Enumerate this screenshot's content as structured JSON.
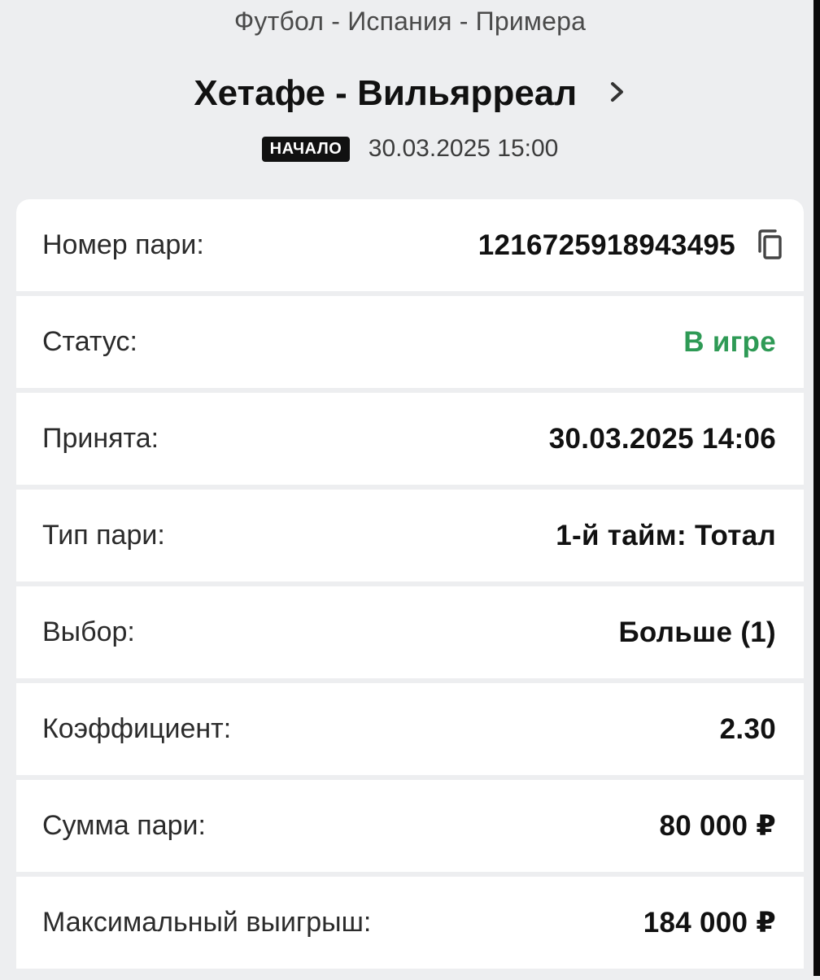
{
  "header": {
    "breadcrumb": "Футбол - Испания - Примера",
    "match_title": "Хетафе - Вильярреал",
    "start_badge": "НАЧАЛО",
    "start_datetime": "30.03.2025 15:00"
  },
  "bet_details": {
    "rows": [
      {
        "label": "Номер пари:",
        "value": "1216725918943495"
      },
      {
        "label": "Статус:",
        "value": "В игре"
      },
      {
        "label": "Принята:",
        "value": "30.03.2025 14:06"
      },
      {
        "label": "Тип пари:",
        "value": "1-й тайм: Тотал"
      },
      {
        "label": "Выбор:",
        "value": "Больше (1)"
      },
      {
        "label": "Коэффициент:",
        "value": "2.30"
      },
      {
        "label": "Сумма пари:",
        "value": "80 000 ₽"
      },
      {
        "label": "Максимальный выигрыш:",
        "value": "184 000 ₽"
      }
    ]
  },
  "icons": {
    "title_chevron": "chevron-right-icon",
    "bet_number_copy": "copy-icon"
  },
  "colors": {
    "status_active": "#2e9a55",
    "badge_bg": "#111111",
    "page_bg": "#edeef0"
  }
}
